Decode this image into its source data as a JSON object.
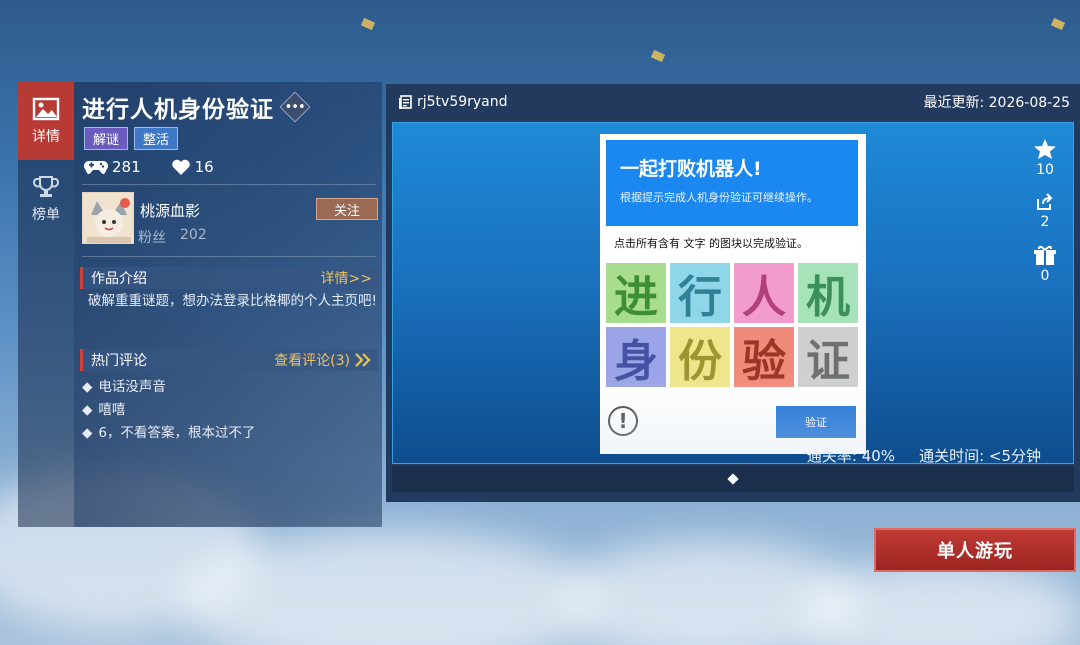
{
  "nav": {
    "items": [
      {
        "label": "详情",
        "icon": "picture-icon",
        "active": true
      },
      {
        "label": "榜单",
        "icon": "trophy-icon",
        "active": false
      }
    ]
  },
  "level": {
    "title": "进行人机身份验证",
    "tags": [
      "解谜",
      "整活"
    ],
    "plays": "281",
    "likes": "16"
  },
  "author": {
    "name": "桃源血影",
    "fans_label": "粉丝",
    "fans_count": "202",
    "follow_label": "关注"
  },
  "intro": {
    "header": "作品介绍",
    "link": "详情>>",
    "text": "破解重重谜题，想办法登录比格椰的个人主页吧!"
  },
  "comments": {
    "header": "热门评论",
    "link": "查看评论(3)",
    "items": [
      "电话没声音",
      "嘻嘻",
      "6，不看答案，根本过不了"
    ]
  },
  "preview": {
    "id": "rj5tv59ryand",
    "updated": "最近更新: 2026-08-25",
    "stars": "10",
    "shares": "2",
    "gifts": "0",
    "pass_rate": "通关率: 40%",
    "pass_time": "通关时间: <5分钟"
  },
  "captcha": {
    "title": "一起打败机器人!",
    "subtitle": "根据提示完成人机身份验证可继续操作。",
    "instruction": "点击所有含有 文字 的图块以完成验证。",
    "cells": [
      {
        "char": "进",
        "bg": "#a8dc8e",
        "fg": "#3e8e35"
      },
      {
        "char": "行",
        "bg": "#8fd6e8",
        "fg": "#2f8198"
      },
      {
        "char": "人",
        "bg": "#f29cce",
        "fg": "#b2407a"
      },
      {
        "char": "机",
        "bg": "#a6e3b9",
        "fg": "#3b8f5b"
      },
      {
        "char": "身",
        "bg": "#9aa4e6",
        "fg": "#4552a3"
      },
      {
        "char": "份",
        "bg": "#eee68a",
        "fg": "#9e9430"
      },
      {
        "char": "验",
        "bg": "#f08a7a",
        "fg": "#9c3528"
      },
      {
        "char": "证",
        "bg": "#cfcfcf",
        "fg": "#6f6f6f"
      }
    ],
    "warn_symbol": "!",
    "verify_label": "验证"
  },
  "play_button": "单人游玩",
  "colors": {
    "accent_red": "#b83a34",
    "link_gold": "#f0c35a",
    "captcha_blue": "#1b88f2"
  }
}
